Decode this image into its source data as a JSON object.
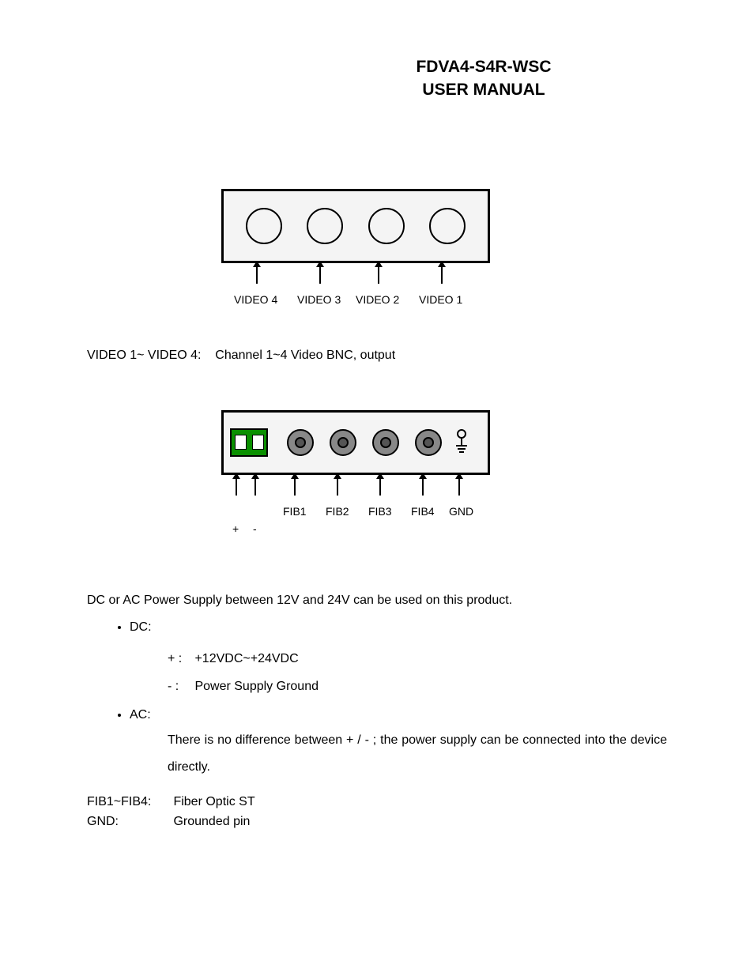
{
  "header": {
    "line1": "FDVA4-S4R-WSC",
    "line2": "USER MANUAL"
  },
  "diagram1": {
    "labels": [
      "VIDEO 4",
      "VIDEO 3",
      "VIDEO 2",
      "VIDEO 1"
    ]
  },
  "desc1": {
    "term": "VIDEO 1~ VIDEO 4:",
    "text": "Channel 1~4 Video BNC, output"
  },
  "diagram2": {
    "plus": "+",
    "minus": "-",
    "labels": [
      "FIB1",
      "FIB2",
      "FIB3",
      "FIB4",
      "GND"
    ]
  },
  "power": {
    "intro": "DC or AC Power Supply between 12V and 24V can be used on this product.",
    "dc_label": "DC:",
    "dc_plus_sym": "+ :",
    "dc_plus_text": "+12VDC~+24VDC",
    "dc_minus_sym": "- :",
    "dc_minus_text": "Power Supply Ground",
    "ac_label": "AC:",
    "ac_text": "There is no difference between  + / - ; the power supply can be connected into the device directly."
  },
  "defs": {
    "fib_term": "FIB1~FIB4:",
    "fib_text": "Fiber Optic ST",
    "gnd_term": "GND:",
    "gnd_text": "Grounded pin"
  }
}
